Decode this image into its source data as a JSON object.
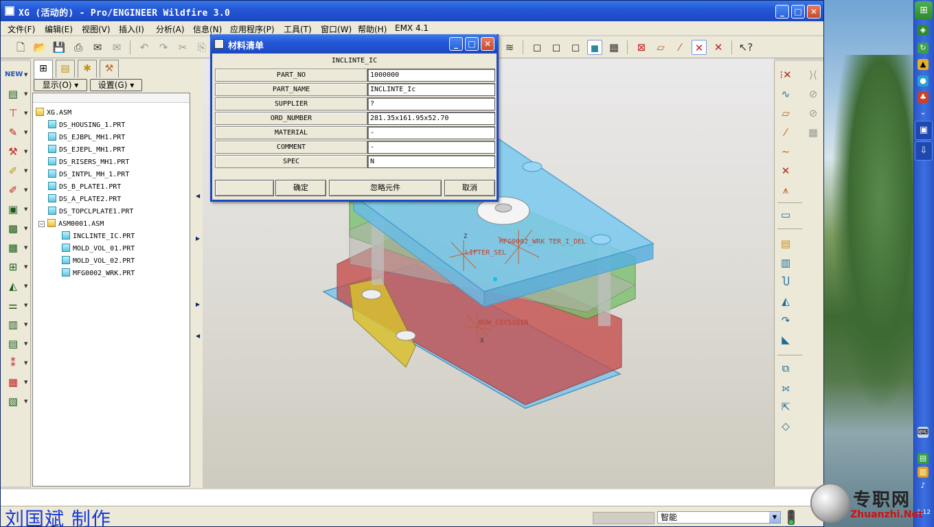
{
  "window": {
    "title": "XG (活动的) - Pro/ENGINEER Wildfire 3.0",
    "minimize": "_",
    "maximize": "□",
    "close": "✕"
  },
  "menu": [
    "文件(F)",
    "编辑(E)",
    "视图(V)",
    "插入(I)",
    "分析(A)",
    "信息(N)",
    "应用程序(P)",
    "工具(T)",
    "窗口(W)",
    "帮助(H)",
    "EMX 4.1"
  ],
  "navigator": {
    "show_label": "显示(O) ▾",
    "settings_label": "设置(G) ▾",
    "tree": [
      {
        "label": "XG.ASM",
        "type": "asm",
        "level": 0
      },
      {
        "label": "DS_HOUSING_1.PRT",
        "type": "prt",
        "level": 1
      },
      {
        "label": "DS_EJBPL_MH1.PRT",
        "type": "prt",
        "level": 1
      },
      {
        "label": "DS_EJEPL_MH1.PRT",
        "type": "prt",
        "level": 1
      },
      {
        "label": "DS_RISERS_MH1.PRT",
        "type": "prt",
        "level": 1
      },
      {
        "label": "DS_INTPL_MH_1.PRT",
        "type": "prt",
        "level": 1
      },
      {
        "label": "DS_B_PLATE1.PRT",
        "type": "prt",
        "level": 1
      },
      {
        "label": "DS_A_PLATE2.PRT",
        "type": "prt",
        "level": 1
      },
      {
        "label": "DS_TOPCLPLATE1.PRT",
        "type": "prt",
        "level": 1
      },
      {
        "label": "ASM0001.ASM",
        "type": "asm",
        "level": 1
      },
      {
        "label": "INCLINTE_IC.PRT",
        "type": "prt",
        "level": 2
      },
      {
        "label": "MOLD_VOL_01.PRT",
        "type": "prt",
        "level": 2
      },
      {
        "label": "MOLD_VOL_02.PRT",
        "type": "prt",
        "level": 2
      },
      {
        "label": "MFG0002_WRK.PRT",
        "type": "prt",
        "level": 2
      }
    ]
  },
  "dialog": {
    "title": "材料清单",
    "heading": "INCLINTE_IC",
    "fields": [
      {
        "label": "PART_NO",
        "value": "1000000"
      },
      {
        "label": "PART_NAME",
        "value": "INCLINTE_Ic"
      },
      {
        "label": "SUPPLIER",
        "value": "?"
      },
      {
        "label": "ORD_NUMBER",
        "value": "281.35x161.95x52.70"
      },
      {
        "label": "MATERIAL",
        "value": "-"
      },
      {
        "label": "COMMENT",
        "value": "-"
      },
      {
        "label": "SPEC",
        "value": "N"
      }
    ],
    "buttons": {
      "ok": "确定",
      "skip": "忽略元件",
      "cancel": "取消"
    }
  },
  "model_labels": {
    "top": "MFG0002_WRK",
    "top2": "TER_I_DEL",
    "lifter": "LIFTER_SEL",
    "csys": "BUW_CSYS1GIN",
    "axis_x": "X",
    "axis_z": "Z"
  },
  "status": {
    "filter": "智能"
  },
  "credit": "刘国斌 制作",
  "watermark": {
    "cn": "专职网",
    "en": "Zhuanzhi.Net"
  },
  "clock": "3:12",
  "colors": {
    "titlebar": "#2458d8",
    "plate_blue": "#7cc8ec",
    "plate_green": "#7cc070",
    "plate_red": "#c85050",
    "plate_yellow": "#d8c030"
  }
}
